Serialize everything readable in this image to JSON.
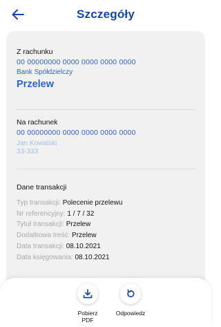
{
  "header": {
    "title": "Szczegóły",
    "back_icon": "arrow-left-icon"
  },
  "from": {
    "label": "Z rachunku",
    "account": "00 00000000 0000 0000 0000 0000",
    "bank": "Bank Spółdzielczy",
    "type": "Przelew"
  },
  "to": {
    "label": "Na rachunek",
    "account": "00 00000000 0000 0000 0000 0000",
    "name": "Jan Kowalski",
    "city": "33-333"
  },
  "details": {
    "label": "Dane transakcji",
    "rows": [
      {
        "key": "Typ transakcji: ",
        "value": "Polecenie przelewu"
      },
      {
        "key": "Nr referencyjny: ",
        "value": "1 / 7 / 32"
      },
      {
        "key": "Tytuł transakcji: ",
        "value": "Przelew"
      },
      {
        "key": "Dodatkowa treść: ",
        "value": "Przelew"
      },
      {
        "key": "Data transakcji: ",
        "value": "08.10.2021"
      },
      {
        "key": "Data księgowania: ",
        "value": "08.10.2021"
      }
    ]
  },
  "actions": {
    "download_pdf": {
      "label": "Pobierz PDF",
      "icon": "download-icon"
    },
    "reply": {
      "label": "Odpowiedz",
      "icon": "reply-icon"
    }
  },
  "colors": {
    "accent": "#2f62c9",
    "title": "#1546a6",
    "muted_blue": "#a6bde6",
    "muted_text": "#a9a9a9",
    "card": "#f1f1f1"
  }
}
